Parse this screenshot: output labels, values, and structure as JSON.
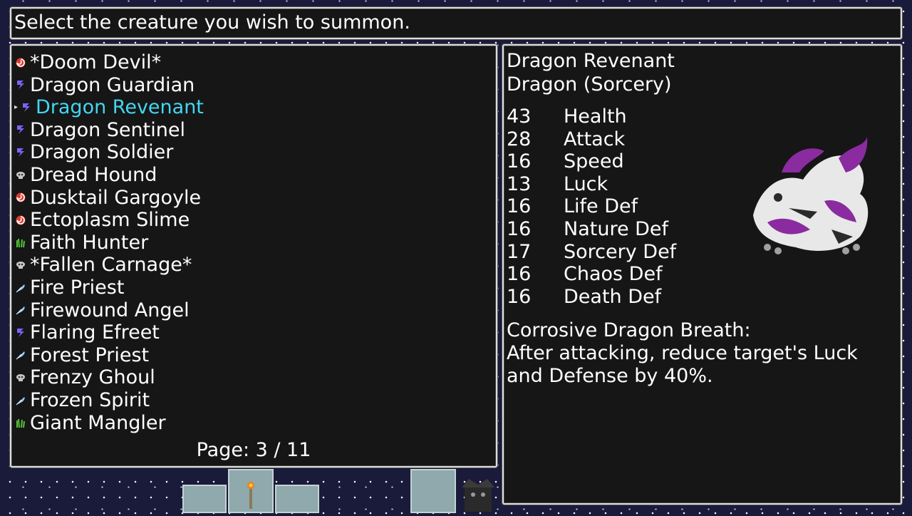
{
  "prompt": "Select the creature you wish to summon.",
  "creatures": [
    {
      "label": "*Doom Devil*",
      "element": "chaos"
    },
    {
      "label": "Dragon Guardian",
      "element": "sorcery"
    },
    {
      "label": "Dragon Revenant",
      "element": "sorcery",
      "selected": true
    },
    {
      "label": "Dragon Sentinel",
      "element": "sorcery"
    },
    {
      "label": "Dragon Soldier",
      "element": "sorcery"
    },
    {
      "label": "Dread Hound",
      "element": "death"
    },
    {
      "label": "Dusktail Gargoyle",
      "element": "chaos"
    },
    {
      "label": "Ectoplasm Slime",
      "element": "chaos"
    },
    {
      "label": "Faith Hunter",
      "element": "nature"
    },
    {
      "label": "*Fallen Carnage*",
      "element": "death"
    },
    {
      "label": "Fire Priest",
      "element": "life"
    },
    {
      "label": "Firewound Angel",
      "element": "life"
    },
    {
      "label": "Flaring Efreet",
      "element": "sorcery"
    },
    {
      "label": "Forest Priest",
      "element": "life"
    },
    {
      "label": "Frenzy Ghoul",
      "element": "death"
    },
    {
      "label": "Frozen Spirit",
      "element": "life"
    },
    {
      "label": "Giant Mangler",
      "element": "nature"
    }
  ],
  "page_label": "Page: 3 / 11",
  "detail": {
    "name": "Dragon Revenant",
    "type": "Dragon (Sorcery)",
    "stats": [
      {
        "value": "43",
        "name": "Health"
      },
      {
        "value": "28",
        "name": "Attack"
      },
      {
        "value": "16",
        "name": "Speed"
      },
      {
        "value": "13",
        "name": "Luck"
      },
      {
        "value": "16",
        "name": "Life Def"
      },
      {
        "value": "16",
        "name": "Nature Def"
      },
      {
        "value": "17",
        "name": "Sorcery Def"
      },
      {
        "value": "16",
        "name": "Chaos Def"
      },
      {
        "value": "16",
        "name": "Death Def"
      }
    ],
    "ability_name": "Corrosive Dragon Breath:",
    "ability_text": "After attacking, reduce target's Luck and Defense by 40%."
  },
  "colors": {
    "selected_text": "#43d6f0",
    "chaos": "#e03a2f",
    "sorcery": "#7b63ff",
    "death": "#c8c8c8",
    "nature": "#56c23a",
    "life": "#9ad0ff"
  },
  "icons": {
    "chaos": "chaos-swirl-icon",
    "sorcery": "sorcery-bolt-icon",
    "death": "death-skull-icon",
    "nature": "nature-grass-icon",
    "life": "life-feather-icon"
  }
}
